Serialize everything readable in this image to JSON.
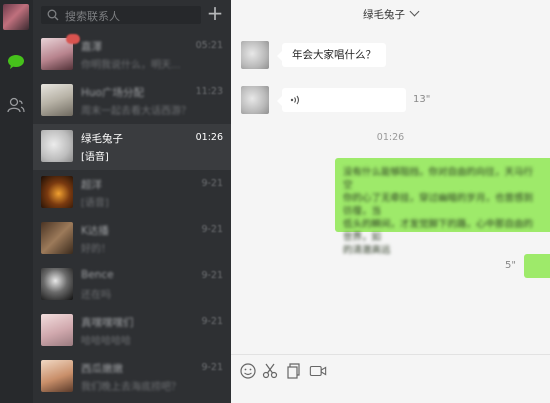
{
  "search": {
    "placeholder": "搜索联系人"
  },
  "conversations": [
    {
      "name": "嘉澤",
      "preview": "你明我说什么，明天...",
      "time": "05:21"
    },
    {
      "name": "Huo广场分配",
      "preview": "周末一起去看大话西游？",
      "time": "11:23"
    },
    {
      "name": "绿毛兔子",
      "preview": "[语音]",
      "time": "01:26"
    },
    {
      "name": "超洋",
      "preview": "[语音]",
      "time": "9-21"
    },
    {
      "name": "K达播",
      "preview": "好的！",
      "time": "9-21"
    },
    {
      "name": "Bence",
      "preview": "还在吗",
      "time": "9-21"
    },
    {
      "name": "真嘿嘿嘿们",
      "preview": "哈哈哈哈哈",
      "time": "9-21"
    },
    {
      "name": "西瓜嫩嫩",
      "preview": "我们晚上去海底捞吧？",
      "time": "9-21"
    }
  ],
  "chat": {
    "title": "绿毛兔子",
    "messages": [
      {
        "text": "年会大家唱什么？"
      },
      {
        "voice_duration": "13\""
      }
    ],
    "divider_time": "01:26",
    "outgoing": {
      "lines": [
        "没有什么能够阻挡，你对自由的向往，天马行空",
        "你的心了无牵挂，穿过幽暗的岁月，也曾感到彷徨，当",
        "低头的瞬间，才发觉脚下的路，心中那自由的世界，如",
        "的清澈高远"
      ],
      "voice_duration": "5\""
    }
  },
  "colors": {
    "accent_green": "#9eea6a",
    "rail": "#27292c",
    "list": "#2e3033"
  }
}
